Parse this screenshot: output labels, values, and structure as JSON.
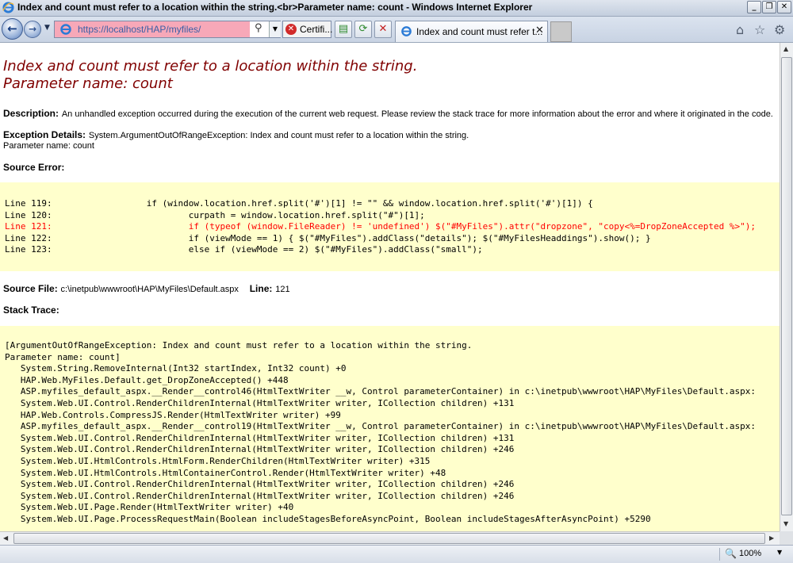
{
  "window": {
    "title": "Index and count must refer to a location within the string.<br>Parameter name: count - Windows Internet Explorer",
    "controls": {
      "minimize": "_",
      "restore": "❐",
      "close": "✕"
    }
  },
  "navbar": {
    "url": "https://localhost/HAP/myfiles/",
    "cert_label": "Certifi...",
    "tab_label": "Index and count must refer t...",
    "icons": [
      "back-arrow-icon",
      "forward-arrow-icon",
      "ie-page-icon",
      "search-icon",
      "certificate-error-icon",
      "compatibility-icon",
      "refresh-icon",
      "stop-icon",
      "home-icon",
      "favorites-star-icon",
      "gear-icon"
    ]
  },
  "error": {
    "title_line1": "Index and count must refer to a location within the string.",
    "title_line2": "Parameter name: count",
    "description_label": "Description:",
    "description_text": "An unhandled exception occurred during the execution of the current web request. Please review the stack trace for more information about the error and where it originated in the code.",
    "exception_label": "Exception Details:",
    "exception_text": "System.ArgumentOutOfRangeException: Index and count must refer to a location within the string.",
    "exception_text2": "Parameter name: count",
    "source_error_label": "Source Error:",
    "source_lines": [
      "Line 119:                  if (window.location.href.split('#')[1] != \"\" && window.location.href.split('#')[1]) {",
      "Line 120:                          curpath = window.location.href.split(\"#\")[1];",
      "Line 121:                          if (typeof (window.FileReader) != 'undefined') $(\"#MyFiles\").attr(\"dropzone\", \"copy<%=DropZoneAccepted %>\");",
      "Line 122:                          if (viewMode == 1) { $(\"#MyFiles\").addClass(\"details\"); $(\"#MyFilesHeaddings\").show(); }",
      "Line 123:                          else if (viewMode == 2) $(\"#MyFiles\").addClass(\"small\");"
    ],
    "source_file_label": "Source File:",
    "source_file_value": "c:\\inetpub\\wwwroot\\HAP\\MyFiles\\Default.aspx",
    "line_label": "Line:",
    "line_value": "121",
    "stack_trace_label": "Stack Trace:",
    "stack_lines": [
      "[ArgumentOutOfRangeException: Index and count must refer to a location within the string.",
      "Parameter name: count]",
      "   System.String.RemoveInternal(Int32 startIndex, Int32 count) +0",
      "   HAP.Web.MyFiles.Default.get_DropZoneAccepted() +448",
      "   ASP.myfiles_default_aspx.__Render__control46(HtmlTextWriter __w, Control parameterContainer) in c:\\inetpub\\wwwroot\\HAP\\MyFiles\\Default.aspx:",
      "   System.Web.UI.Control.RenderChildrenInternal(HtmlTextWriter writer, ICollection children) +131",
      "   HAP.Web.Controls.CompressJS.Render(HtmlTextWriter writer) +99",
      "   ASP.myfiles_default_aspx.__Render__control19(HtmlTextWriter __w, Control parameterContainer) in c:\\inetpub\\wwwroot\\HAP\\MyFiles\\Default.aspx:",
      "   System.Web.UI.Control.RenderChildrenInternal(HtmlTextWriter writer, ICollection children) +131",
      "   System.Web.UI.Control.RenderChildrenInternal(HtmlTextWriter writer, ICollection children) +246",
      "   System.Web.UI.HtmlControls.HtmlForm.RenderChildren(HtmlTextWriter writer) +315",
      "   System.Web.UI.HtmlControls.HtmlContainerControl.Render(HtmlTextWriter writer) +48",
      "   System.Web.UI.Control.RenderChildrenInternal(HtmlTextWriter writer, ICollection children) +246",
      "   System.Web.UI.Control.RenderChildrenInternal(HtmlTextWriter writer, ICollection children) +246",
      "   System.Web.UI.Page.Render(HtmlTextWriter writer) +40",
      "   System.Web.UI.Page.ProcessRequestMain(Boolean includeStagesBeforeAsyncPoint, Boolean includeStagesAfterAsyncPoint) +5290"
    ]
  },
  "statusbar": {
    "zoom": "100%"
  },
  "colors": {
    "error_title": "#800000",
    "highlight_line": "#ff0000",
    "code_background": "#ffffcc",
    "address_error": "#f7a8b8"
  }
}
